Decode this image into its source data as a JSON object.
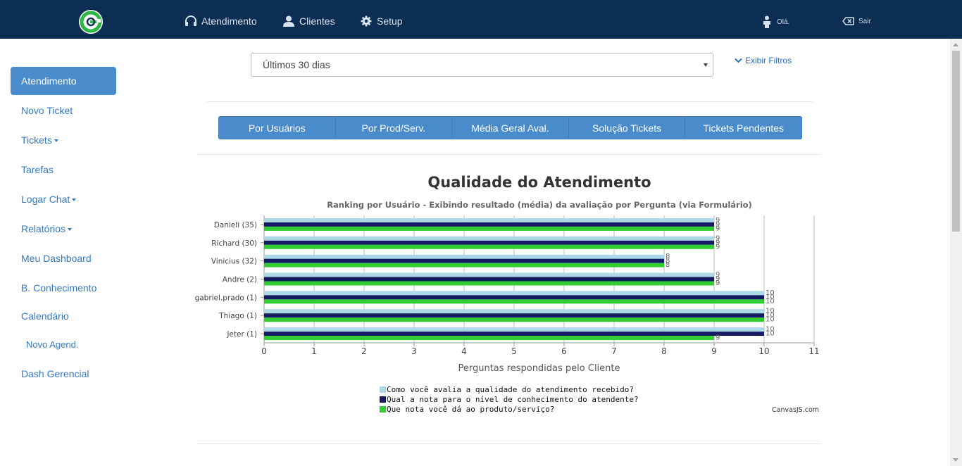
{
  "header": {
    "nav": [
      {
        "label": "Atendimento",
        "icon": "headphones-icon"
      },
      {
        "label": "Clientes",
        "icon": "user-icon"
      },
      {
        "label": "Setup",
        "icon": "gear-icon"
      }
    ],
    "greeting": "Olá.",
    "logout_label": "Sair",
    "colors": {
      "bar": "#0b2e52",
      "logo": "#2fb544"
    }
  },
  "sidebar": {
    "items": [
      {
        "label": "Atendimento",
        "active": true
      },
      {
        "label": "Novo Ticket"
      },
      {
        "label": "Tickets",
        "dropdown": true
      },
      {
        "label": "Tarefas"
      },
      {
        "label": "Logar Chat",
        "dropdown": true
      },
      {
        "label": "Relatórios",
        "dropdown": true
      },
      {
        "label": "Meu Dashboard"
      },
      {
        "label": "B. Conhecimento"
      },
      {
        "label": "Calendário"
      },
      {
        "label": "Novo Agend."
      },
      {
        "label": "Dash Gerencial"
      }
    ]
  },
  "filters": {
    "period_value": "Últimos 30 dias",
    "show_filters_label": "Exibir Filtros"
  },
  "tabs": [
    "Por Usuários",
    "Por Prod/Serv.",
    "Média Geral Aval.",
    "Solução Tickets",
    "Tickets Pendentes"
  ],
  "chart_data": {
    "type": "bar",
    "orientation": "horizontal",
    "title": "Qualidade do Atendimento",
    "subtitle": "Ranking por Usuário - Exibindo resultado (média) da avaliação por Pergunta (via Formulário)",
    "xlabel": "Perguntas respondidas pelo Cliente",
    "xlim": [
      0,
      11
    ],
    "ticks": [
      0,
      1,
      2,
      3,
      4,
      5,
      6,
      7,
      8,
      9,
      10,
      11
    ],
    "grid": true,
    "categories": [
      "Danieli (35)",
      "Richard (30)",
      "Vinicius (32)",
      "Andre (2)",
      "gabriel.prado (1)",
      "Thiago (1)",
      "Jeter (1)"
    ],
    "series": [
      {
        "name": "Como você avalia a qualidade do atendimento recebido?",
        "color": "#add8e6",
        "values": [
          9,
          9,
          8,
          9,
          10,
          10,
          10
        ]
      },
      {
        "name": "Qual a nota para o nível de  conhecimento do atendente?",
        "color": "#141b63",
        "values": [
          9,
          9,
          8,
          9,
          10,
          10,
          10
        ]
      },
      {
        "name": "Que nota você dá ao produto/serviço?",
        "color": "#32cd32",
        "values": [
          9,
          9,
          8,
          9,
          10,
          10,
          9
        ]
      }
    ],
    "legend_position": "bottom",
    "credit": "CanvasJS.com"
  }
}
